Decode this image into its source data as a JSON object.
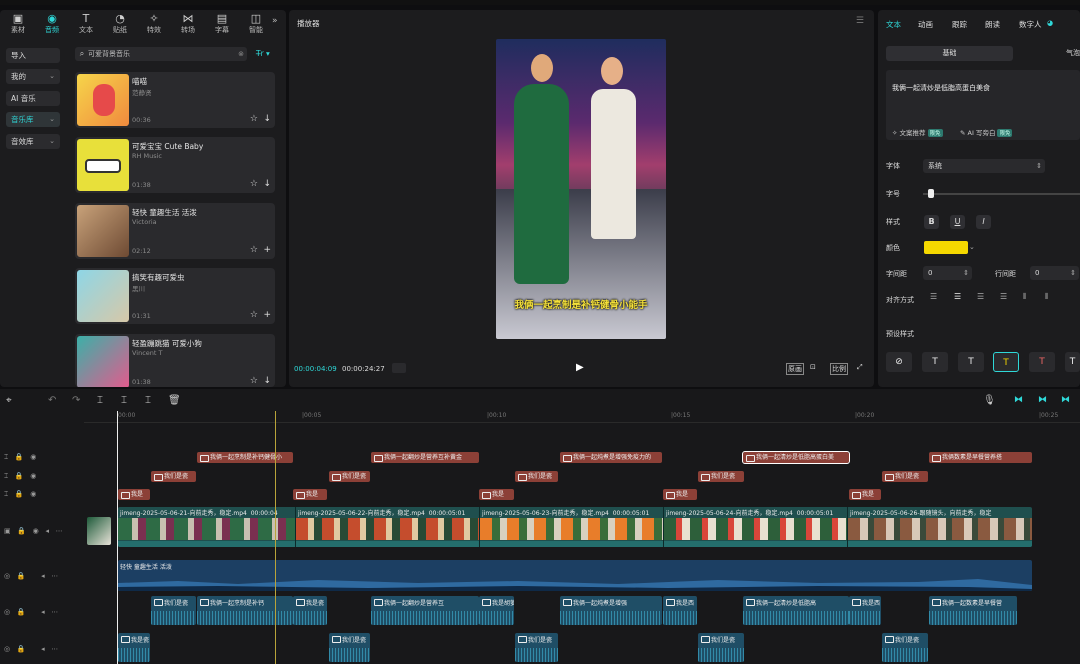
{
  "nav_tabs": [
    {
      "label": "素材",
      "icon": "media-icon"
    },
    {
      "label": "音频",
      "icon": "audio-icon"
    },
    {
      "label": "文本",
      "icon": "text-icon"
    },
    {
      "label": "贴纸",
      "icon": "sticker-icon"
    },
    {
      "label": "特效",
      "icon": "effects-icon"
    },
    {
      "label": "转场",
      "icon": "transition-icon"
    },
    {
      "label": "字幕",
      "icon": "caption-icon"
    },
    {
      "label": "智能",
      "icon": "smart-icon"
    }
  ],
  "side_menu": [
    {
      "label": "导入",
      "chev": ""
    },
    {
      "label": "我的",
      "chev": "⌄"
    },
    {
      "label": "AI 音乐",
      "chev": ""
    },
    {
      "label": "音乐库",
      "chev": "⌄"
    },
    {
      "label": "音效库",
      "chev": "⌄"
    }
  ],
  "search": {
    "placeholder": "可爱背景音乐",
    "filter": "T̶r ▾"
  },
  "music_cards": [
    {
      "title": "喵喵",
      "artist": "范静贤",
      "duration": "00:36",
      "action": "↓"
    },
    {
      "title": "可爱宝宝  Cute Baby",
      "artist": "RH Music",
      "duration": "01:38",
      "action": "↓"
    },
    {
      "title": "轻快 童趣生活 活泼",
      "artist": "Victoria",
      "duration": "02:12",
      "action": "+"
    },
    {
      "title": "搞笑有趣可爱虫",
      "artist": "黑川",
      "duration": "01:31",
      "action": "+"
    },
    {
      "title": "轻盈蹦跳猫 可爱小狗",
      "artist": "Vincent T",
      "duration": "01:38",
      "action": "↓"
    }
  ],
  "player": {
    "title": "播放器",
    "subtitle": "我俩一起烹制是补钙健骨小能手",
    "current_time": "00:00:04:09",
    "total_time": "00:00:24:27",
    "right_controls": [
      "原画",
      "⊡",
      "比例",
      "⤢"
    ]
  },
  "right": {
    "tabs": [
      "文本",
      "动画",
      "跟踪",
      "朗读",
      "数字人"
    ],
    "subtabs": [
      "基础",
      "气泡"
    ],
    "text_content": "我俩一起清炒是低脂高蛋白美食",
    "link1": "文案推荐",
    "link2": "AI 写旁白",
    "badge": "限免",
    "font_label": "字体",
    "font_value": "系统",
    "size_label": "字号",
    "style_label": "样式",
    "color_label": "颜色",
    "color_value": "#f5d800",
    "spacing_label": "字间距",
    "spacing_value": "0",
    "line_label": "行间距",
    "line_value": "0",
    "align_label": "对齐方式",
    "preset_label": "预设样式"
  },
  "timeline": {
    "ruler": [
      "00:00",
      "|00:05",
      "|00:10",
      "|00:15",
      "|00:20",
      "|00:25"
    ],
    "sub_clips": [
      "我俩一起烹制是补钙健骨小",
      "我俩一起翻炒是营养互补黄金",
      "我俩一起炖煮是增强免疫力的",
      "我俩一起清炒是低脂高蛋白美",
      "我俩数素是早餐营养搭"
    ],
    "text_row2": [
      "我们是瓷",
      "我们是瓷",
      "我们是瓷",
      "我们是瓷",
      "我们是瓷"
    ],
    "text_row3": [
      "我是",
      "我是",
      "我是",
      "我是",
      "我是"
    ],
    "video_segments": [
      {
        "name": "jimeng-2025-05-06-21-向前走秀，稳定.mp4",
        "dur": "00:00:04"
      },
      {
        "name": "jimeng-2025-05-06-22-向前走秀，稳定.mp4",
        "dur": "00:00:05:01"
      },
      {
        "name": "jimeng-2025-05-06-23-向前走秀，稳定.mp4",
        "dur": "00:00:05:01"
      },
      {
        "name": "jimeng-2025-05-06-24-向前走秀，稳定.mp4",
        "dur": "00:00:05:01"
      },
      {
        "name": "jimeng-2025-05-06-26-跟随镜头，向前走秀，稳定",
        "dur": ""
      }
    ],
    "music_track": "轻快 童趣生活 活泼",
    "audio_row1": [
      "我们是瓷",
      "我俩一起烹制是补钙",
      "我是瓷",
      "我俩一起翻炒是营养互",
      "我是胡萝",
      "我俩一起炖煮是增强",
      "我是西",
      "我俩一起清炒是低脂高",
      "我是西",
      "我俩一起数素是早餐营"
    ],
    "audio_row2": [
      "我是瓷",
      "我们是瓷",
      "我们是瓷",
      "我们是瓷",
      "我们是瓷"
    ]
  }
}
